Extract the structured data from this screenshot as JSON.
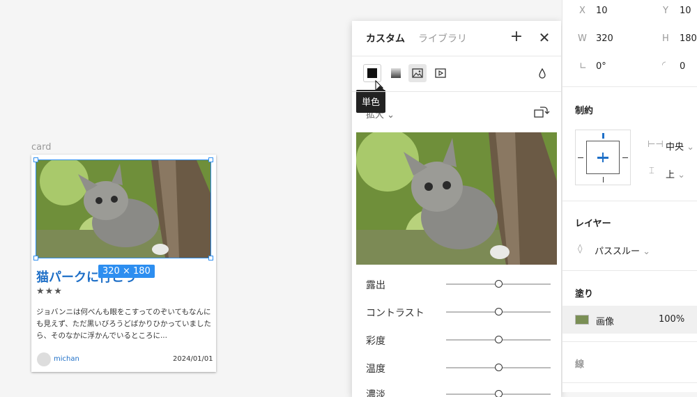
{
  "canvas": {
    "frame_label": "card",
    "size_badge": "320 × 180",
    "card": {
      "title": "猫パークに行こう",
      "stars": "★★★",
      "body": "ジョバンニは何べんも眼をこすってのぞいてもなんにも見えず、ただ黒いびろうどばかりひかっていましたら、そのなかに浮かんでいるところに...",
      "author": "michan",
      "date": "2024/01/01"
    }
  },
  "picker": {
    "tab_custom": "カスタム",
    "tab_library": "ライブラリ",
    "add_icon": "+",
    "close_icon": "✕",
    "tooltip": "単色",
    "fit_value": "拡大",
    "adjustments": [
      {
        "label": "露出",
        "value": 0
      },
      {
        "label": "コントラスト",
        "value": 0
      },
      {
        "label": "彩度",
        "value": 0
      },
      {
        "label": "温度",
        "value": 0
      },
      {
        "label": "濃淡",
        "value": 0
      }
    ]
  },
  "props": {
    "x_label": "X",
    "x_value": "10",
    "y_label": "Y",
    "y_value": "10",
    "w_label": "W",
    "w_value": "320",
    "h_label": "H",
    "h_value": "180",
    "rotation_value": "0°",
    "radius_value": "0",
    "constraints_title": "制約",
    "constraint_h": "中央",
    "constraint_v": "上",
    "layer_title": "レイヤー",
    "blend_mode": "パススルー",
    "fill_title": "塗り",
    "fill_type": "画像",
    "fill_opacity": "100%",
    "stroke_title": "線"
  },
  "colors": {
    "selection": "#2d8ef0",
    "accent_blue": "#1e6fc7"
  }
}
